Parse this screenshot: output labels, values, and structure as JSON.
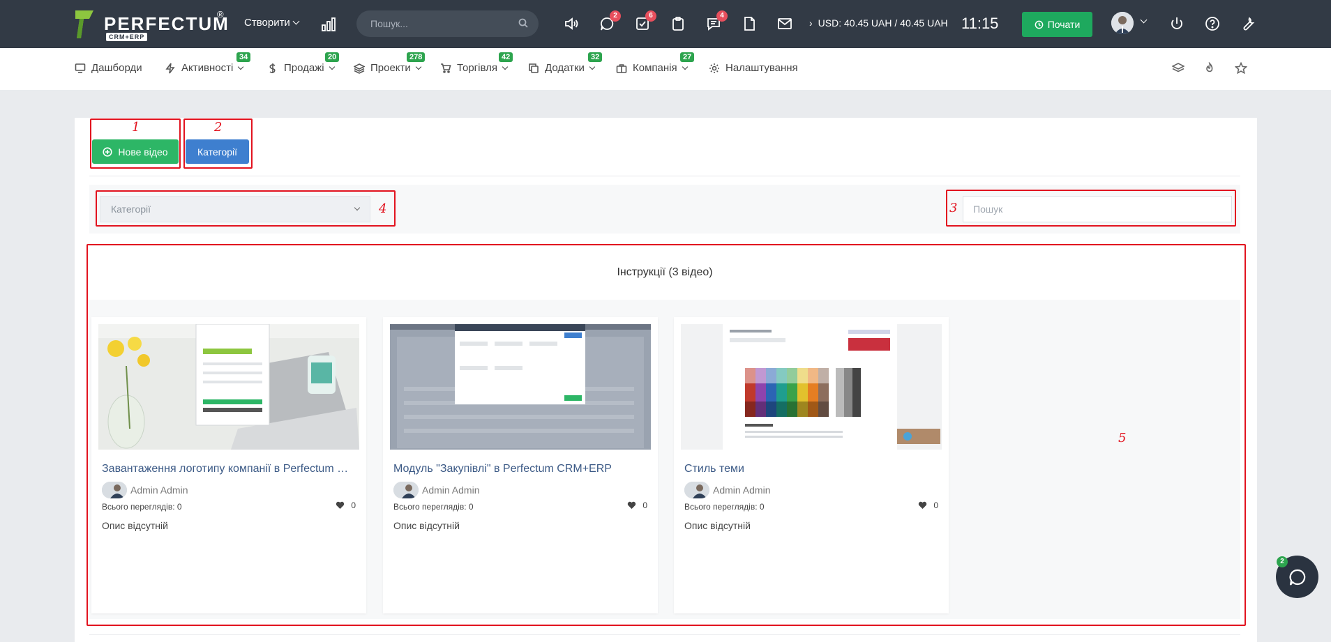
{
  "header": {
    "logo_text": "PERFECTUM",
    "logo_reg": "®",
    "logo_sub": "CRM+ERP",
    "create_label": "Створити",
    "search_placeholder": "Пошук...",
    "badges": {
      "chat": "2",
      "tasks": "6",
      "messages": "4"
    },
    "currency_text": "USD: 40.45 UAH / 40.45 UAH",
    "clock": "11:15",
    "start_label": "Почати"
  },
  "nav": {
    "items": [
      {
        "label": "Дашборди",
        "icon": "monitor-icon"
      },
      {
        "label": "Активності",
        "badge": "34",
        "icon": "bolt-icon"
      },
      {
        "label": "Продажі",
        "badge": "20",
        "icon": "dollar-icon"
      },
      {
        "label": "Проекти",
        "badge": "278",
        "icon": "layers-icon"
      },
      {
        "label": "Торгівля",
        "badge": "42",
        "icon": "cart-icon"
      },
      {
        "label": "Додатки",
        "badge": "32",
        "icon": "copy-icon"
      },
      {
        "label": "Компанія",
        "badge": "27",
        "icon": "briefcase-icon"
      },
      {
        "label": "Налаштування",
        "icon": "gear-icon"
      }
    ]
  },
  "toolbar": {
    "new_video_label": "Нове відео",
    "categories_label": "Категорії"
  },
  "filters": {
    "category_placeholder": "Категорії",
    "search_placeholder": "Пошук"
  },
  "section": {
    "title": "Інструкції (3 відео)"
  },
  "videos": [
    {
      "title": "Завантаження логотипу компанії в Perfectum CRM+ERP",
      "author": "Admin Admin",
      "views": "Всього переглядів: 0",
      "likes": "0",
      "description": "Опис відсутній"
    },
    {
      "title": "Модуль \"Закупівлі\" в Perfectum CRM+ERP",
      "author": "Admin Admin",
      "views": "Всього переглядів: 0",
      "likes": "0",
      "description": "Опис відсутній"
    },
    {
      "title": "Стиль теми",
      "author": "Admin Admin",
      "views": "Всього переглядів: 0",
      "likes": "0",
      "description": "Опис відсутній"
    }
  ],
  "annotations": {
    "n1": "1",
    "n2": "2",
    "n3": "3",
    "n4": "4",
    "n5": "5"
  },
  "chat_widget": {
    "badge": "2"
  },
  "colors": {
    "topbar": "#323a45",
    "green": "#2db666",
    "blue": "#3e7fcf",
    "annotation_red": "#e2131f"
  }
}
